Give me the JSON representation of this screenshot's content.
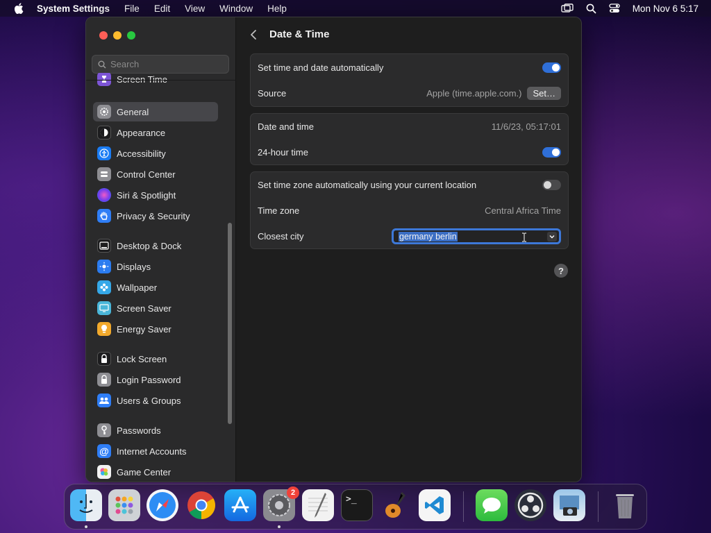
{
  "menubar": {
    "app_name": "System Settings",
    "items": [
      "File",
      "Edit",
      "View",
      "Window",
      "Help"
    ],
    "clock": "Mon Nov 6  5:17"
  },
  "sidebar": {
    "search_placeholder": "Search",
    "items": [
      {
        "label": "Screen Time",
        "icon": "hourglass-icon",
        "color": "#7d55d6"
      },
      {
        "label": "General",
        "icon": "gear-icon",
        "color": "#8e8e93",
        "selected": true
      },
      {
        "label": "Appearance",
        "icon": "appearance-icon",
        "color": "#1c1c1e"
      },
      {
        "label": "Accessibility",
        "icon": "accessibility-icon",
        "color": "#1a7cf4"
      },
      {
        "label": "Control Center",
        "icon": "control-center-icon",
        "color": "#8e8e93"
      },
      {
        "label": "Siri & Spotlight",
        "icon": "siri-icon",
        "color": "#c13ac6"
      },
      {
        "label": "Privacy & Security",
        "icon": "hand-icon",
        "color": "#2f7ef6"
      },
      {
        "label": "Desktop & Dock",
        "icon": "dock-icon",
        "color": "#1c1c1e"
      },
      {
        "label": "Displays",
        "icon": "sun-icon",
        "color": "#2b7cf0"
      },
      {
        "label": "Wallpaper",
        "icon": "flower-icon",
        "color": "#35a8e8"
      },
      {
        "label": "Screen Saver",
        "icon": "screen-saver-icon",
        "color": "#4ab6d9"
      },
      {
        "label": "Energy Saver",
        "icon": "bulb-icon",
        "color": "#f2a92c"
      },
      {
        "label": "Lock Screen",
        "icon": "lock-icon",
        "color": "#1c1c1e"
      },
      {
        "label": "Login Password",
        "icon": "lock-icon",
        "color": "#8e8e93"
      },
      {
        "label": "Users & Groups",
        "icon": "users-icon",
        "color": "#2f7ef6"
      },
      {
        "label": "Passwords",
        "icon": "key-icon",
        "color": "#8e8e93"
      },
      {
        "label": "Internet Accounts",
        "icon": "at-icon",
        "color": "#2f7ef6"
      },
      {
        "label": "Game Center",
        "icon": "game-center-icon",
        "color": "#f2f2f2"
      }
    ]
  },
  "content": {
    "title": "Date & Time",
    "group1": {
      "auto_label": "Set time and date automatically",
      "auto_on": true,
      "source_label": "Source",
      "source_value": "Apple (time.apple.com.)",
      "set_button": "Set…"
    },
    "group2": {
      "datetime_label": "Date and time",
      "datetime_value": "11/6/23, 05:17:01",
      "hour24_label": "24-hour time",
      "hour24_on": true
    },
    "group3": {
      "auto_tz_label": "Set time zone automatically using your current location",
      "auto_tz_on": false,
      "tz_label": "Time zone",
      "tz_value": "Central Africa Time",
      "city_label": "Closest city",
      "city_value": "germany berlin"
    },
    "help": "?"
  },
  "dock": {
    "apps": [
      {
        "name": "Finder",
        "running": true
      },
      {
        "name": "Launchpad"
      },
      {
        "name": "Safari"
      },
      {
        "name": "Chrome"
      },
      {
        "name": "App Store"
      },
      {
        "name": "System Settings",
        "running": true,
        "badge": "2"
      },
      {
        "name": "TextEdit"
      },
      {
        "name": "Terminal"
      },
      {
        "name": "GarageBand"
      },
      {
        "name": "VS Code"
      },
      {
        "name": "Messages"
      },
      {
        "name": "OBS"
      },
      {
        "name": "Preview"
      },
      {
        "name": "Trash"
      }
    ]
  }
}
